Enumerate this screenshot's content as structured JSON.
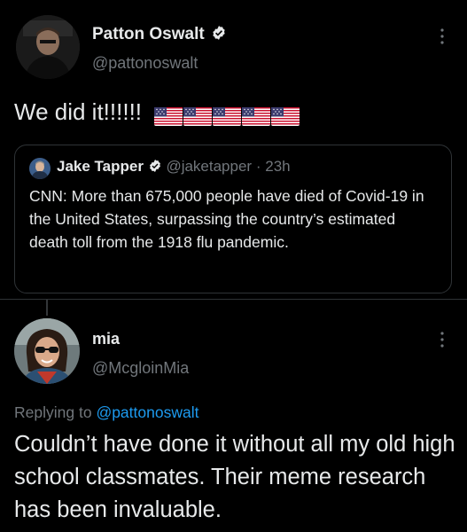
{
  "tweet": {
    "author_name": "Patton Oswalt",
    "author_handle": "@pattonoswalt",
    "text": "We did it!!!!!!",
    "flag_count": 5,
    "quoted": {
      "author_name": "Jake Tapper",
      "author_handle": "@jaketapper",
      "separator": "·",
      "time": "23h",
      "text": "CNN: More than 675,000 people have died of Covid-19 in the United States, surpassing the country’s estimated death toll from the 1918 flu pandemic."
    }
  },
  "reply": {
    "author_name": "mia",
    "author_handle": "@McgloinMia",
    "replying_to_label": "Replying to",
    "replying_to_handle": "@pattonoswalt",
    "text": "Couldn’t have done it without all my old high school classmates. Their meme research has been invaluable."
  },
  "colors": {
    "background": "#000000",
    "primary_text": "#e7e9ea",
    "secondary_text": "#71767b",
    "link": "#1d9bf0",
    "verified": "#e7e9ea"
  },
  "icons": [
    "verified-badge-icon",
    "more-options-icon",
    "us-flag-icon"
  ]
}
